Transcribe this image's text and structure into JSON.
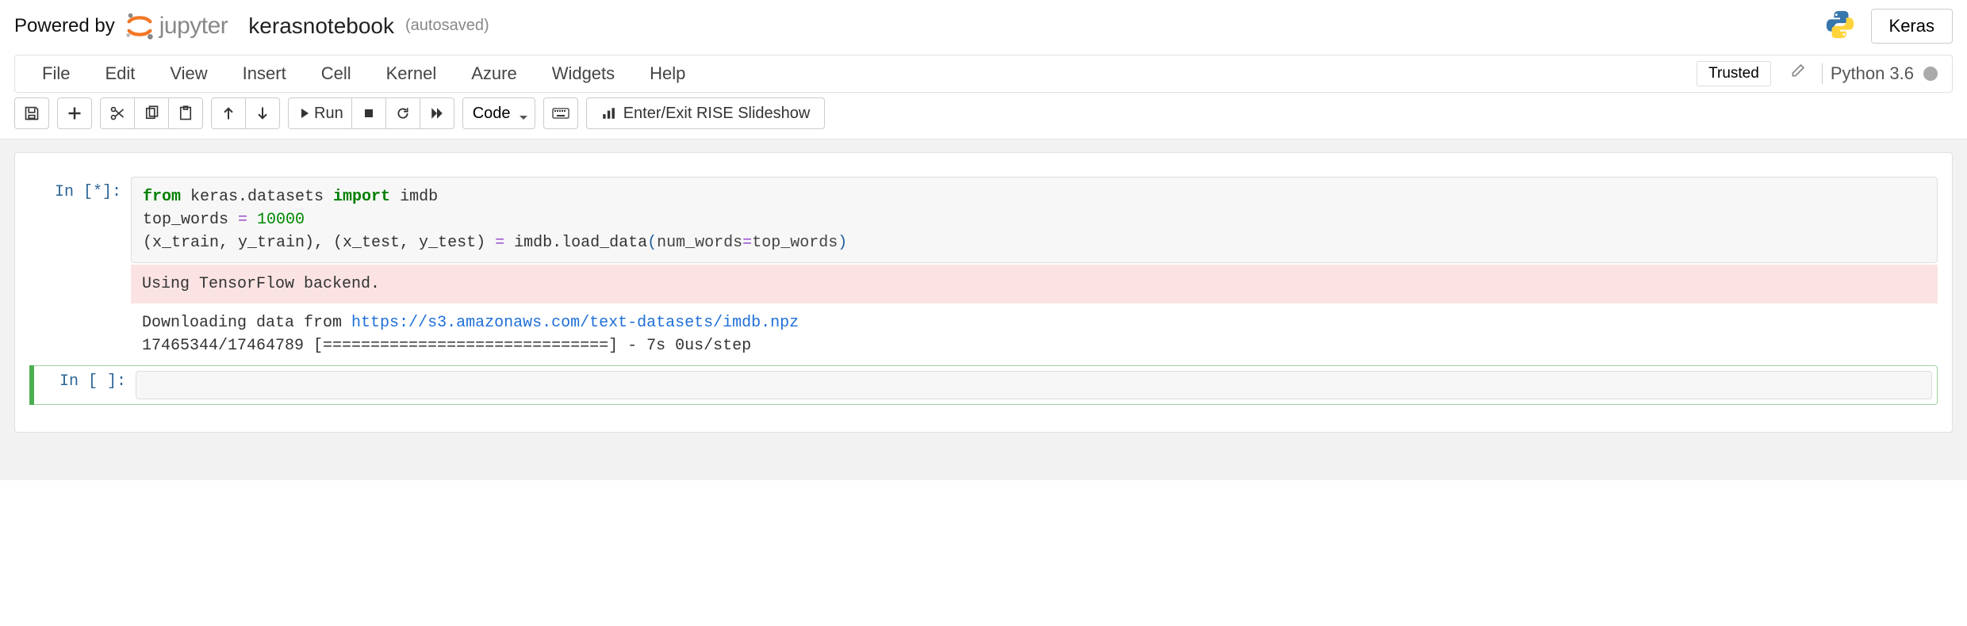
{
  "header": {
    "powered_by": "Powered by",
    "logo_text": "jupyter",
    "notebook_name": "kerasnotebook",
    "autosave": "(autosaved)",
    "keras_label": "Keras"
  },
  "menubar": {
    "items": [
      "File",
      "Edit",
      "View",
      "Insert",
      "Cell",
      "Kernel",
      "Azure",
      "Widgets",
      "Help"
    ],
    "trusted": "Trusted",
    "kernel": "Python 3.6"
  },
  "toolbar": {
    "run_label": "Run",
    "celltype": "Code",
    "rise_label": "Enter/Exit RISE Slideshow"
  },
  "cells": [
    {
      "prompt": "In [*]:",
      "code": {
        "line1_kw1": "from",
        "line1_mod": " keras.datasets ",
        "line1_kw2": "import",
        "line1_name": " imdb",
        "line2_var": "top_words ",
        "line2_eq": "=",
        "line2_num": " 10000",
        "line3_pre": "(x_train, y_train), (x_test, y_test) ",
        "line3_eq": "=",
        "line3_call": " imdb.load_data",
        "line3_lpar": "(",
        "line3_kwname": "num_words",
        "line3_kwop": "=",
        "line3_kwval": "top_words",
        "line3_rpar": ")"
      },
      "stderr": "Using TensorFlow backend.",
      "stdout_pre": "Downloading data from ",
      "stdout_url": "https://s3.amazonaws.com/text-datasets/imdb.npz",
      "stdout_line2": "17465344/17464789 [==============================] - 7s 0us/step"
    },
    {
      "prompt": "In [ ]:"
    }
  ]
}
